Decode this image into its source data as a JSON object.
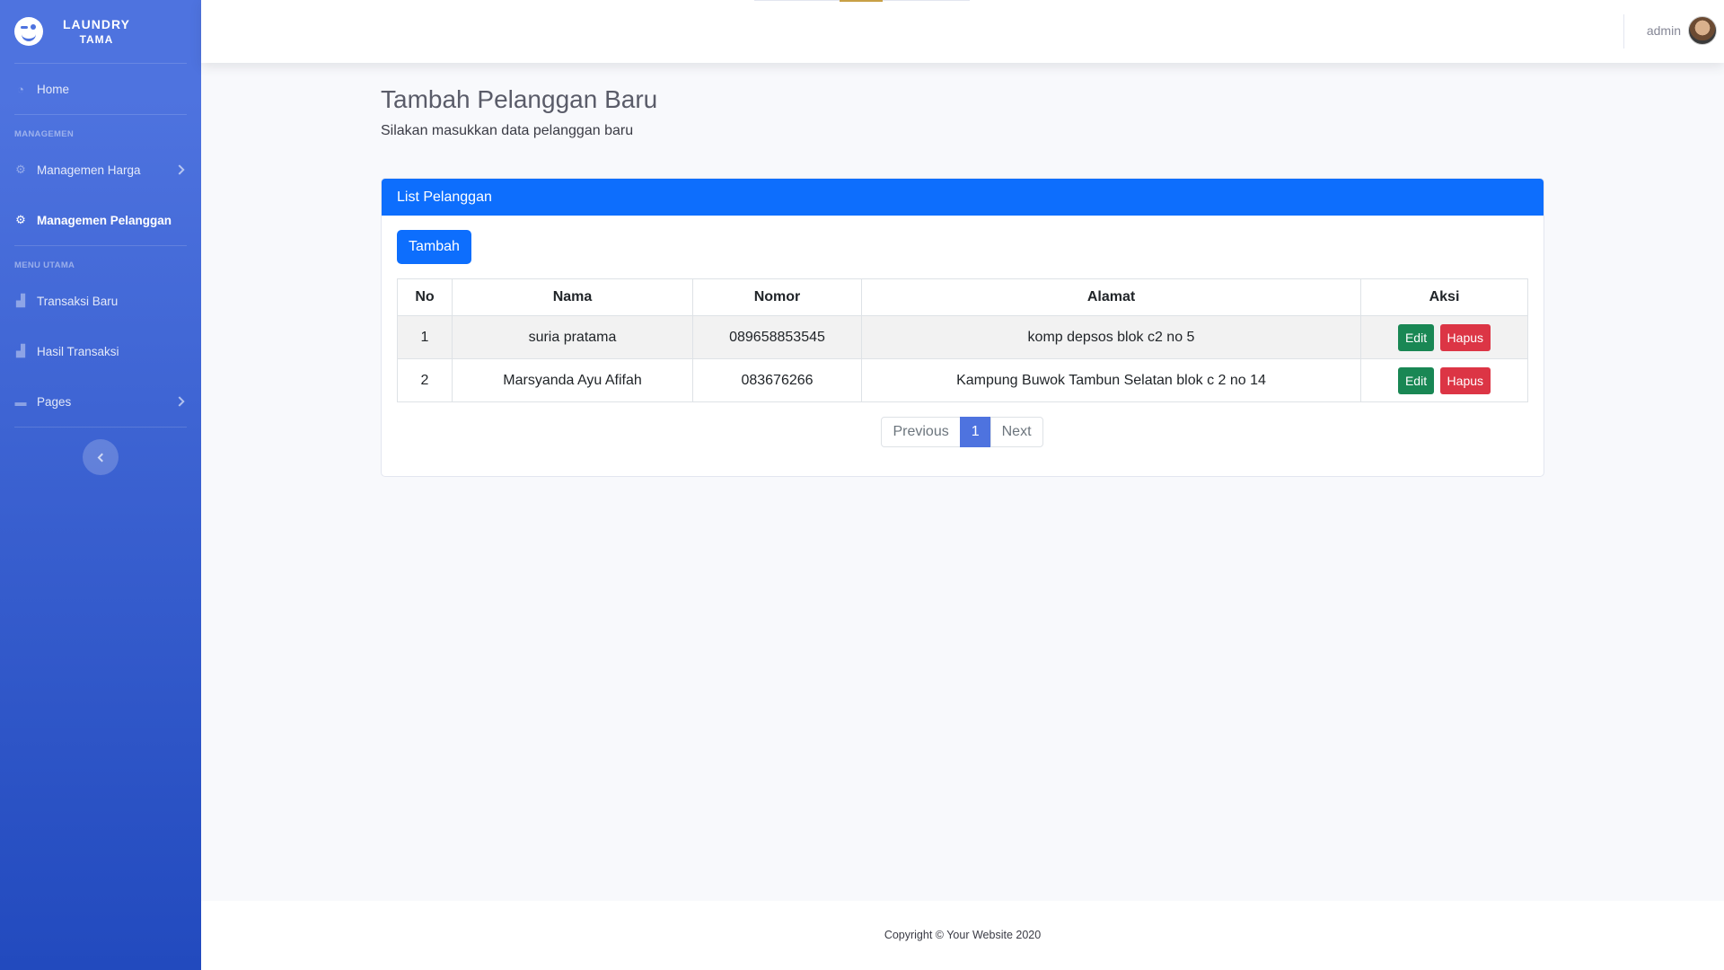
{
  "brand": {
    "line1": "LAUNDRY",
    "line2": "TAMA"
  },
  "sidebar": {
    "home": "Home",
    "heading_manage": "MANAGEMEN",
    "manage_price": "Managemen Harga",
    "manage_customer": "Managemen Pelanggan",
    "heading_main": "MENU UTAMA",
    "new_transaction": "Transaksi Baru",
    "transaction_results": "Hasil Transaksi",
    "pages": "Pages"
  },
  "topbar": {
    "username": "admin"
  },
  "page": {
    "title": "Tambah Pelanggan Baru",
    "subtitle": "Silakan masukkan data pelanggan baru"
  },
  "card": {
    "header": "List Pelanggan",
    "add_button": "Tambah",
    "columns": [
      "No",
      "Nama",
      "Nomor",
      "Alamat",
      "Aksi"
    ],
    "rows": [
      {
        "no": "1",
        "nama": "suria pratama",
        "nomor": "089658853545",
        "alamat": "komp depsos blok c2 no 5",
        "edit": "Edit",
        "hapus": "Hapus"
      },
      {
        "no": "2",
        "nama": "Marsyanda Ayu Afifah",
        "nomor": "083676266",
        "alamat": "Kampung Buwok Tambun Selatan blok c 2 no 14",
        "edit": "Edit",
        "hapus": "Hapus"
      }
    ]
  },
  "pagination": {
    "previous": "Previous",
    "current": "1",
    "next": "Next"
  },
  "footer": {
    "text": "Copyright © Your Website 2020"
  },
  "icons": {
    "brand": "laugh-wink-icon",
    "home": "dashboard-icon",
    "manage": "cog-icon",
    "chart": "chart-area-icon",
    "pages": "folder-icon"
  },
  "colors": {
    "primary": "#0d6efd",
    "sidebar": "#4e73df",
    "success": "#198754",
    "danger": "#dc3545"
  }
}
